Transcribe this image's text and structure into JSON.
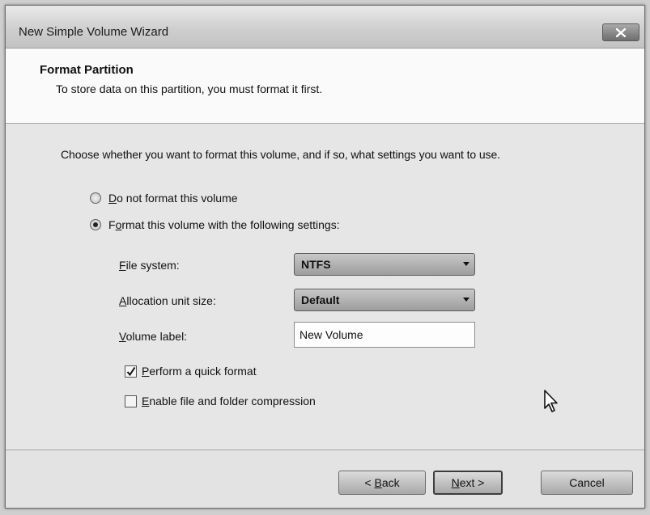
{
  "window": {
    "title": "New Simple Volume Wizard",
    "close_icon": "close-icon"
  },
  "header": {
    "title": "Format Partition",
    "subtitle": "To store data on this partition, you must format it first."
  },
  "body": {
    "prompt": "Choose whether you want to format this volume, and if so, what settings you want to use.",
    "options": [
      {
        "label_key": "D",
        "label_rest": "o not format this volume",
        "selected": false
      },
      {
        "label_key": "o",
        "label_pre": "F",
        "label_rest": "rmat this volume with the following settings:",
        "selected": true
      }
    ],
    "file_system": {
      "label_key": "F",
      "label_rest": "ile system:",
      "value": "NTFS"
    },
    "allocation_unit": {
      "label_key": "A",
      "label_rest": "llocation unit size:",
      "value": "Default"
    },
    "volume_label": {
      "label_key": "V",
      "label_rest": "olume label:",
      "value": "New Volume"
    },
    "quick_format": {
      "label_key": "P",
      "label_rest": "erform a quick format",
      "checked": true
    },
    "compression": {
      "label_key": "E",
      "label_rest": "nable file and folder compression",
      "checked": false
    }
  },
  "footer": {
    "back": {
      "pre": "< ",
      "key": "B",
      "rest": "ack"
    },
    "next": {
      "key": "N",
      "rest": "ext >"
    },
    "cancel": "Cancel"
  }
}
